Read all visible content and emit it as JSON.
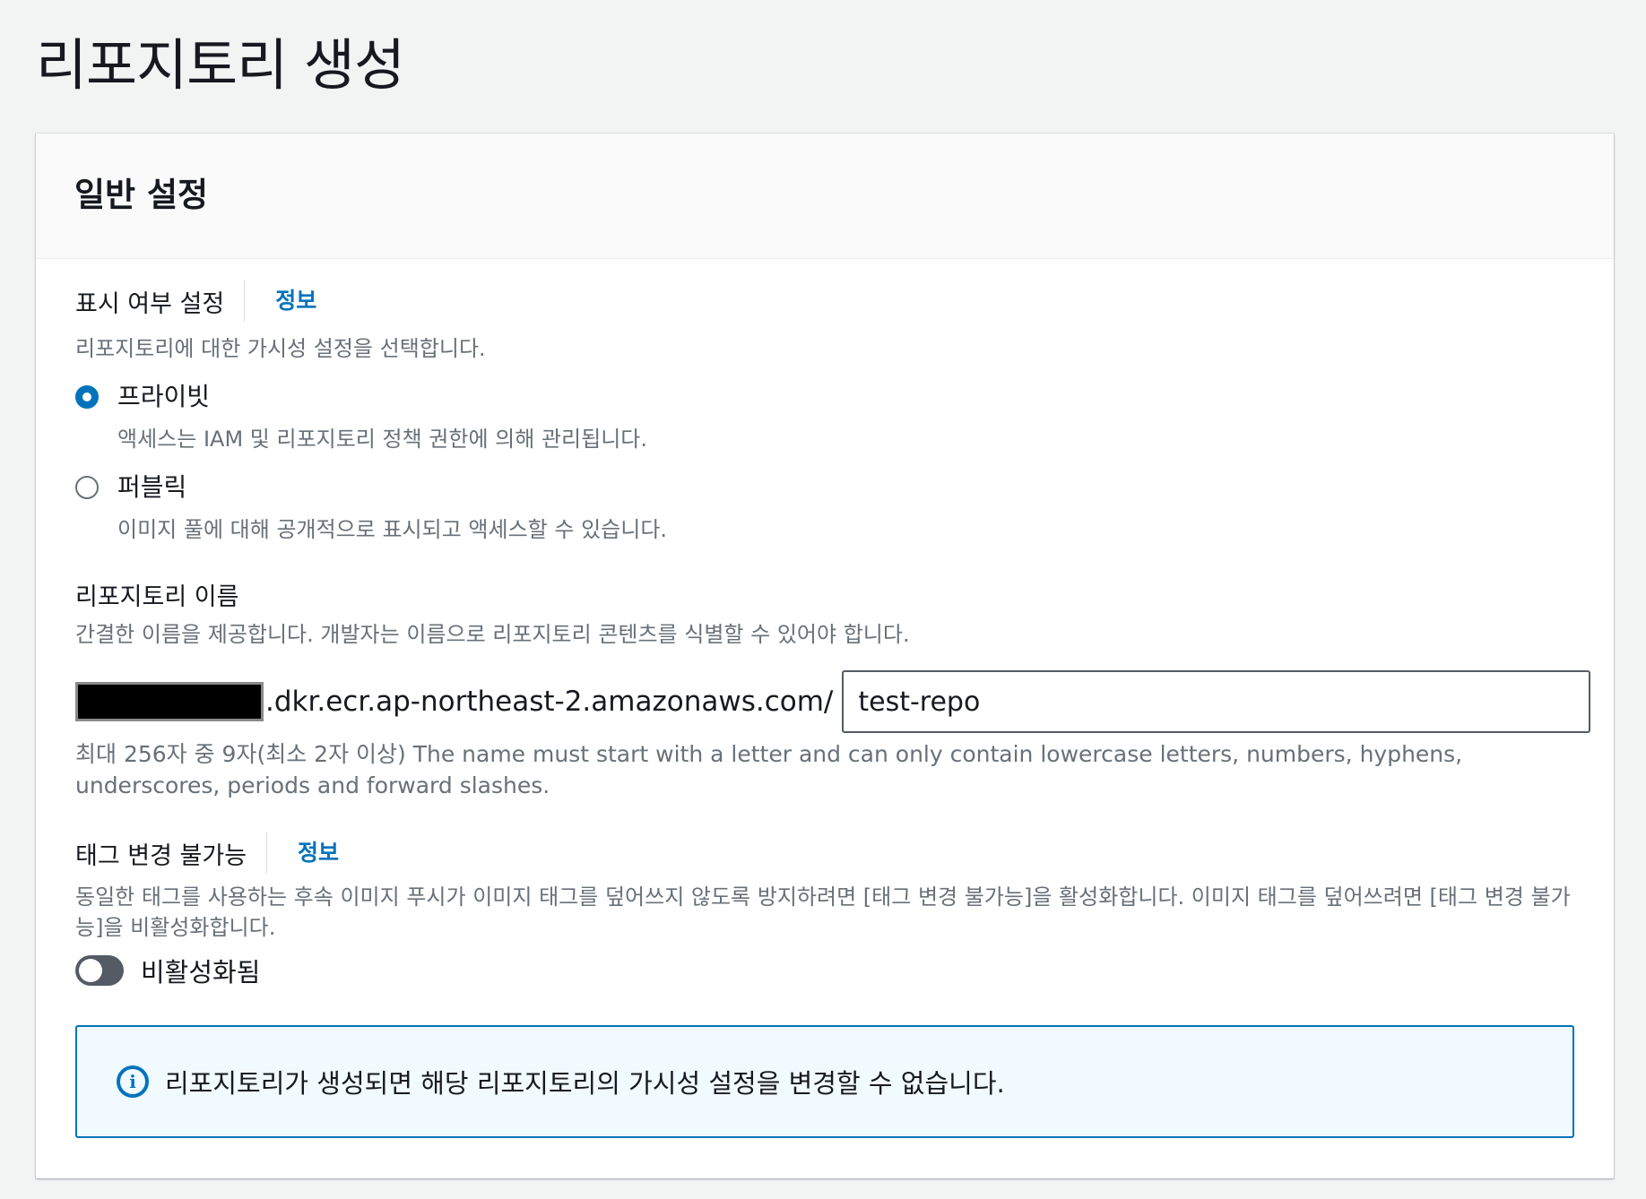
{
  "page": {
    "title": "리포지토리 생성"
  },
  "general": {
    "title": "일반 설정",
    "visibility": {
      "label": "표시 여부 설정",
      "info": "정보",
      "description": "리포지토리에 대한 가시성 설정을 선택합니다.",
      "options": [
        {
          "label": "프라이빗",
          "description": "액세스는 IAM 및 리포지토리 정책 권한에 의해 관리됩니다.",
          "selected": true
        },
        {
          "label": "퍼블릭",
          "description": "이미지 풀에 대해 공개적으로 표시되고 액세스할 수 있습니다.",
          "selected": false
        }
      ]
    },
    "repo_name": {
      "label": "리포지토리 이름",
      "description": "간결한 이름을 제공합니다. 개발자는 이름으로 리포지토리 콘텐츠를 식별할 수 있어야 합니다.",
      "uri_suffix": ".dkr.ecr.ap-northeast-2.amazonaws.com/",
      "value": "test-repo",
      "constraint": "최대 256자 중 9자(최소 2자 이상) The name must start with a letter and can only contain lowercase letters, numbers, hyphens, underscores, periods and forward slashes."
    },
    "tag_immutability": {
      "label": "태그 변경 불가능",
      "info": "정보",
      "description": "동일한 태그를 사용하는 후속 이미지 푸시가 이미지 태그를 덮어쓰지 않도록 방지하려면 [태그 변경 불가능]을 활성화합니다. 이미지 태그를 덮어쓰려면 [태그 변경 불가능]을 비활성화합니다.",
      "state_label": "비활성화됨",
      "enabled": false
    },
    "alert": {
      "icon": "info-circle-icon",
      "text": "리포지토리가 생성되면 해당 리포지토리의 가시성 설정을 변경할 수 없습니다."
    }
  },
  "colors": {
    "accent": "#0073bb",
    "toggle_off": "#545b64",
    "alert_bg": "#f1faff"
  }
}
